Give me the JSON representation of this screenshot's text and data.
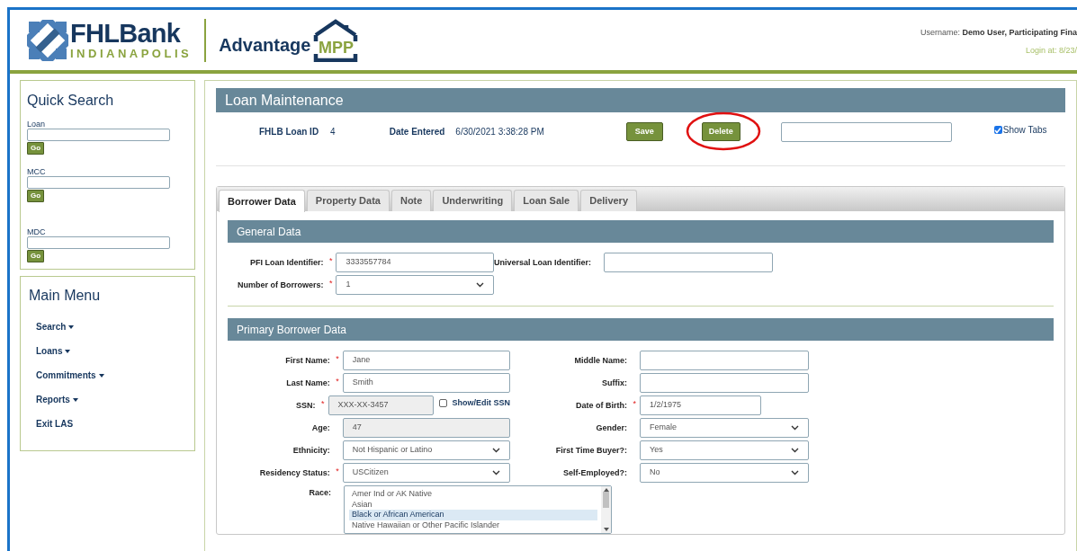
{
  "header": {
    "brand": "FHLBank",
    "brand_sub": "INDIANAPOLIS",
    "product": "Advantage",
    "product_accent": "MPP",
    "username_label": "Username:",
    "username": "Demo User, Participating Fina",
    "login": "Login at: 8/23/"
  },
  "quick_search": {
    "title": "Quick Search",
    "fields": [
      {
        "label": "Loan",
        "button": "Go"
      },
      {
        "label": "MCC",
        "button": "Go"
      },
      {
        "label": "MDC",
        "button": "Go"
      }
    ]
  },
  "main_menu": {
    "title": "Main Menu",
    "items": [
      {
        "label": "Search",
        "has_dropdown": true
      },
      {
        "label": "Loans",
        "has_dropdown": true
      },
      {
        "label": "Commitments",
        "has_dropdown": true
      },
      {
        "label": "Reports",
        "has_dropdown": true
      },
      {
        "label": "Exit LAS",
        "has_dropdown": false
      }
    ]
  },
  "page": {
    "title": "Loan Maintenance",
    "loan_id_label": "FHLB Loan ID",
    "loan_id": "4",
    "date_label": "Date Entered",
    "date": "6/30/2021 3:38:28 PM",
    "buttons": [
      {
        "label": "Save",
        "highlighted": false
      },
      {
        "label": "Delete",
        "highlighted": true
      }
    ],
    "show_tabs": {
      "label": "Show Tabs",
      "checked": true
    }
  },
  "tabs": [
    {
      "label": "Borrower Data",
      "selected": true
    },
    {
      "label": "Property Data",
      "selected": false
    },
    {
      "label": "Note",
      "selected": false
    },
    {
      "label": "Underwriting",
      "selected": false
    },
    {
      "label": "Loan Sale",
      "selected": false
    },
    {
      "label": "Delivery",
      "selected": false
    }
  ],
  "general_data": {
    "title": "General Data",
    "rows": [
      {
        "left": {
          "label": "PFI Loan Identifier:",
          "required_mark": "*",
          "kind": "text",
          "value": "3333557784"
        },
        "right": {
          "label": "Universal Loan Identifier:",
          "kind": "text"
        }
      },
      {
        "left": {
          "label": "Number of Borrowers:",
          "required_mark": "*",
          "kind": "select",
          "value": "1"
        }
      }
    ]
  },
  "primary_borrower": {
    "title": "Primary Borrower Data",
    "rows": [
      {
        "left": {
          "label": "First Name:",
          "required_mark": "*",
          "kind": "text",
          "value": "Jane"
        },
        "right": {
          "label": "Middle Name:",
          "kind": "text"
        }
      },
      {
        "left": {
          "label": "Last Name:",
          "required_mark": "*",
          "kind": "text",
          "value": "Smith"
        },
        "right": {
          "label": "Suffix:",
          "kind": "text"
        }
      },
      {
        "left": {
          "label": "SSN:",
          "required_mark": "*",
          "kind": "readonly_short",
          "value": "XXX-XX-3457",
          "checkbox": {
            "label": "Show/Edit SSN",
            "checked": false
          }
        },
        "right": {
          "label": "Date of Birth:",
          "required_mark": "*",
          "kind": "text_short",
          "value": "1/2/1975"
        }
      },
      {
        "left": {
          "label": "Age:",
          "kind": "readonly",
          "value": "47"
        },
        "right": {
          "label": "Gender:",
          "kind": "select",
          "value": "Female"
        }
      },
      {
        "left": {
          "label": "Ethnicity:",
          "kind": "select",
          "value": "Not Hispanic or Latino"
        },
        "right": {
          "label": "First Time Buyer?:",
          "kind": "select",
          "value": "Yes"
        }
      },
      {
        "left": {
          "label": "Residency Status:",
          "required_mark": "*",
          "kind": "select",
          "value": "USCitizen"
        },
        "right": {
          "label": "Self-Employed?:",
          "kind": "select",
          "value": "No"
        }
      }
    ],
    "race": {
      "label": "Race:",
      "options": [
        {
          "label": "Amer Ind or AK Native",
          "selected": false
        },
        {
          "label": "Asian",
          "selected": false
        },
        {
          "label": "Black or African American",
          "selected": true
        },
        {
          "label": "Native Hawaiian or Other Pacific Islander",
          "selected": false
        }
      ]
    }
  }
}
